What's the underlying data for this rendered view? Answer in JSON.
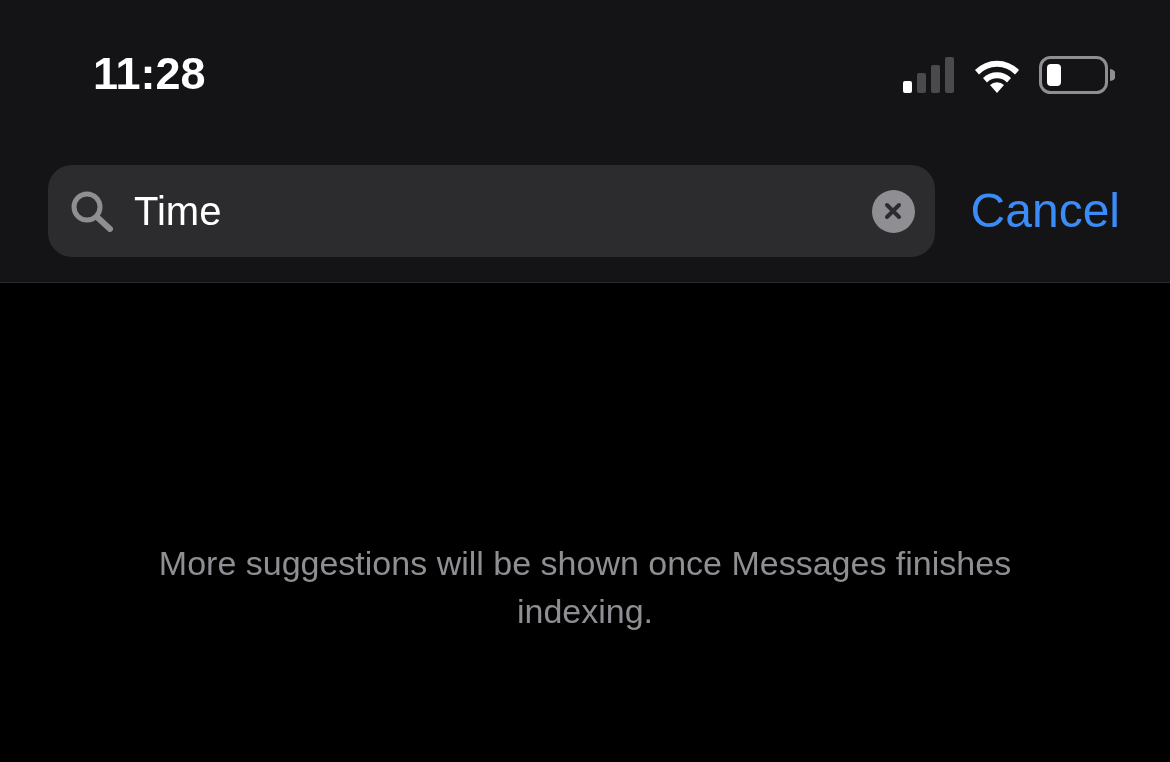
{
  "status_bar": {
    "time": "11:28"
  },
  "search": {
    "value": "Time"
  },
  "cancel_button": {
    "label": "Cancel"
  },
  "message": "More suggestions will be shown once Messages finishes indexing."
}
